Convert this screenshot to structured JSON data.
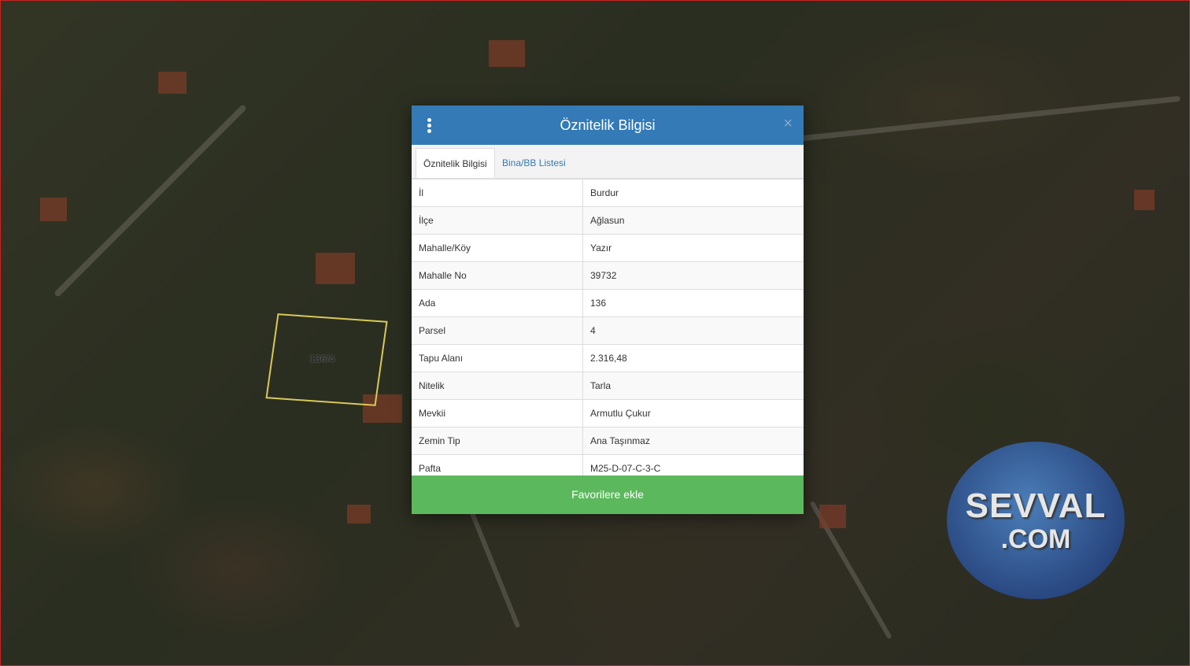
{
  "dialog": {
    "title": "Öznitelik Bilgisi",
    "close_glyph": "×",
    "tabs": [
      {
        "label": "Öznitelik Bilgisi",
        "active": true
      },
      {
        "label": "Bina/BB Listesi",
        "active": false
      }
    ],
    "rows": [
      {
        "key": "İl",
        "value": "Burdur"
      },
      {
        "key": "İlçe",
        "value": "Ağlasun"
      },
      {
        "key": "Mahalle/Köy",
        "value": "Yazır"
      },
      {
        "key": "Mahalle No",
        "value": "39732"
      },
      {
        "key": "Ada",
        "value": "136"
      },
      {
        "key": "Parsel",
        "value": "4"
      },
      {
        "key": "Tapu Alanı",
        "value": "2.316,48"
      },
      {
        "key": "Nitelik",
        "value": "Tarla"
      },
      {
        "key": "Mevkii",
        "value": "Armutlu Çukur"
      },
      {
        "key": "Zemin Tip",
        "value": "Ana Taşınmaz"
      },
      {
        "key": "Pafta",
        "value": "M25-D-07-C-3-C"
      }
    ],
    "favorite_button": "Favorilere ekle"
  },
  "map": {
    "parcel_label": "136/4",
    "parcel_outline_color": "#d8c85a"
  },
  "watermark": {
    "top": "SEVVAL",
    "bottom": ".COM"
  },
  "colors": {
    "header": "#337ab7",
    "button": "#5cb85c"
  }
}
